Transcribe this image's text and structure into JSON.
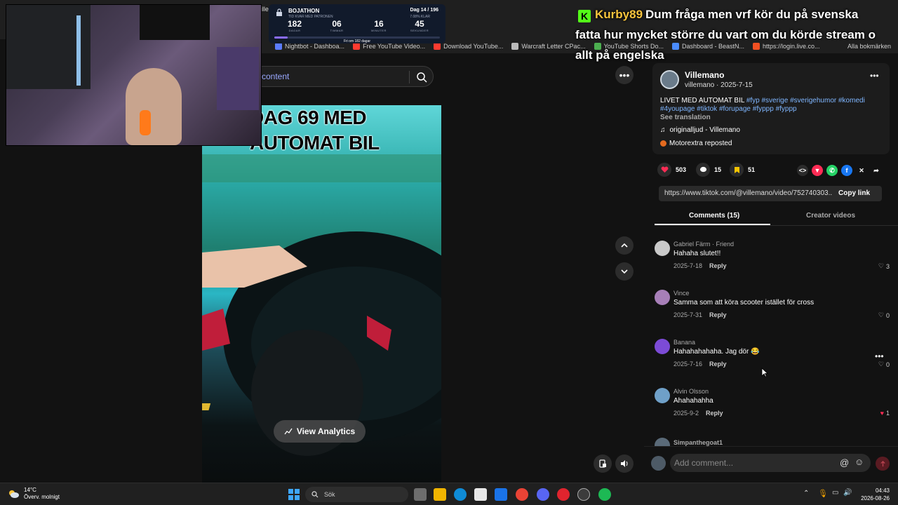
{
  "browser": {
    "tab_title_partial": "Ville",
    "bookmarks": [
      {
        "label": "Nightbot - Dashboa...",
        "color": "#5b7cff"
      },
      {
        "label": "Free YouTube Video...",
        "color": "#ff3b30"
      },
      {
        "label": "Download YouTube...",
        "color": "#ff3b30"
      },
      {
        "label": "Warcraft Letter CPac...",
        "color": "#bbbbbb"
      },
      {
        "label": "YouTube Shorts Do...",
        "color": "#4caf50"
      },
      {
        "label": "Dashboard - BeastN...",
        "color": "#4a8cff"
      },
      {
        "label": "https://login.live.co...",
        "color": "#f25022"
      }
    ],
    "all_bookmarks": "Alla bokmärken"
  },
  "timer": {
    "name": "BOJATHON",
    "subtitle": "TID KVAR MED PATRONEN",
    "day": "Dag 14 / 196",
    "percent": "7.08% KLAR",
    "cells": [
      {
        "num": "182",
        "label": "DAGAR"
      },
      {
        "num": "06",
        "label": "TIMMAR"
      },
      {
        "num": "16",
        "label": "MINUTER"
      },
      {
        "num": "45",
        "label": "SEKUNDER"
      }
    ],
    "progress": 0.0708,
    "footer": "Fri om 182 dagar"
  },
  "chat": {
    "user": "Kurby89",
    "message": "Dum fråga men vrf kör du på svenska fatta hur mycket större du vart om du körde stream o allt på engelska"
  },
  "search": {
    "text": "content"
  },
  "video": {
    "title": "DAG 69 MED AUTOMAT BIL",
    "analytics_label": "View Analytics"
  },
  "post": {
    "author": "Villemano",
    "handle_date": "villemano · 2025-7-15",
    "caption_text": "LIVET MED AUTOMAT BIL ",
    "caption_tags": "#fyp #sverige #sverigehumor #komedi #4youpage #tiktok #forupage #fyppp #fyppp",
    "see_translation": "See translation",
    "sound": "originalljud - Villemano",
    "repost": "Motorextra reposted",
    "likes": "503",
    "comments": "15",
    "saves": "51",
    "link": "https://www.tiktok.com/@villemano/video/752740303...",
    "copy_link": "Copy link",
    "tab_comments": "Comments (15)",
    "tab_creator": "Creator videos"
  },
  "comments": [
    {
      "name": "Gabriel Färm · Friend",
      "text": "Hahaha slutet!!",
      "date": "2025-7-18",
      "likes": "3",
      "liked": false,
      "avatar": "#c9c9c9"
    },
    {
      "name": "Vince",
      "text": "Samma som att köra scooter istället för cross",
      "date": "2025-7-31",
      "likes": "0",
      "liked": false,
      "avatar": "#a77fb8"
    },
    {
      "name": "Banana",
      "text": "Hahahahahaha. Jag dör 😂",
      "date": "2025-7-16",
      "likes": "0",
      "liked": false,
      "avatar": "#7c4bd6"
    },
    {
      "name": "Alvin Olsson",
      "text": "Ahahahahha",
      "date": "2025-9-2",
      "likes": "1",
      "liked": true,
      "avatar": "#6fa0c8"
    }
  ],
  "reply_label": "Reply",
  "partial_comment_name": "Simpanthegoat1",
  "comment_placeholder": "Add comment...",
  "taskbar": {
    "temp": "14°C",
    "weather": "Överv. molnigt",
    "search": "Sök",
    "time": "04:43",
    "date": "2026-08-26"
  }
}
